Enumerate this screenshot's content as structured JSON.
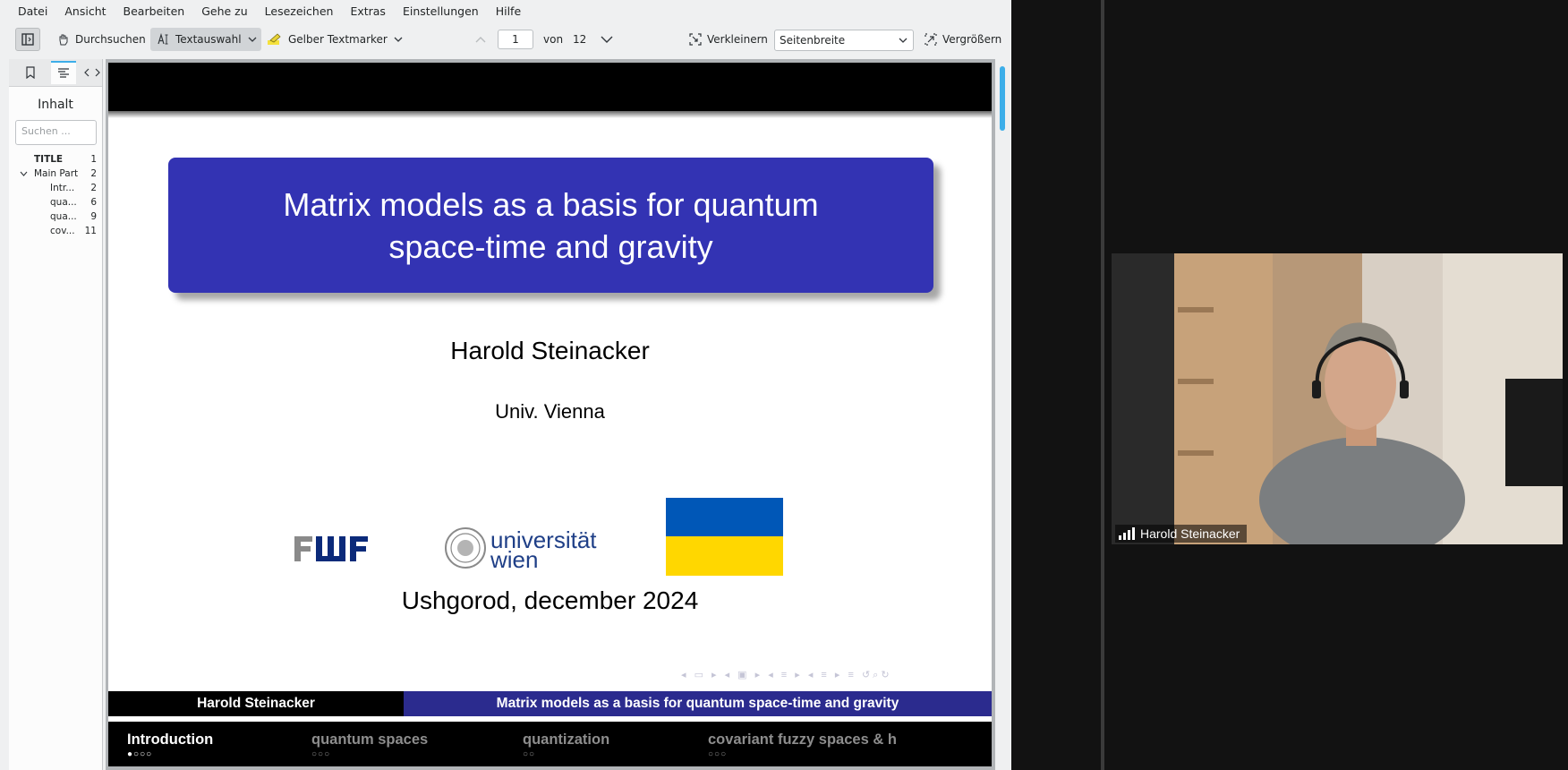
{
  "menubar": [
    "Datei",
    "Ansicht",
    "Bearbeiten",
    "Gehe zu",
    "Lesezeichen",
    "Extras",
    "Einstellungen",
    "Hilfe"
  ],
  "toolbar": {
    "browse_label": "Durchsuchen",
    "textselect_label": "Textauswahl",
    "highlighter_label": "Gelber Textmarker",
    "current_page": "1",
    "of_label": "von",
    "total_pages": "12",
    "zoom_out_label": "Verkleinern",
    "zoom_mode": "Seitenbreite",
    "zoom_in_label": "Vergrößern"
  },
  "sidebar": {
    "title": "Inhalt",
    "search_placeholder": "Suchen ...",
    "toc": [
      {
        "label": "TITLE",
        "page": "1"
      },
      {
        "label": "Main Part",
        "page": "2"
      },
      {
        "label": "Intr...",
        "page": "2"
      },
      {
        "label": "qua...",
        "page": "6"
      },
      {
        "label": "qua...",
        "page": "9"
      },
      {
        "label": "cov...",
        "page": "11"
      }
    ]
  },
  "slide": {
    "title_line1": "Matrix models as a basis for quantum",
    "title_line2": "space-time and gravity",
    "author": "Harold Steinacker",
    "affiliation": "Univ. Vienna",
    "logo_fwf": "FWF",
    "logo_uni_line1": "universität",
    "logo_uni_line2": "wien",
    "place_date": "Ushgorod, december 2024",
    "footer_author": "Harold Steinacker",
    "footer_title": "Matrix models as a basis for quantum space-time and gravity",
    "sections": [
      {
        "label": "Introduction",
        "dots": "●○○○"
      },
      {
        "label": "quantum spaces",
        "dots": "○○○"
      },
      {
        "label": "quantization",
        "dots": "○○"
      },
      {
        "label": "covariant fuzzy spaces & h",
        "dots": "○○○"
      }
    ],
    "colors": {
      "title_box": "#3333b3",
      "footer_right": "#2b2b8e",
      "flag_blue": "#0057b7",
      "flag_yellow": "#ffd700"
    }
  },
  "video": {
    "participant_name": "Harold Steinacker"
  },
  "icons": [
    "sidebar-toggle-icon",
    "hand-icon",
    "text-cursor-icon",
    "highlighter-icon",
    "chevron-up-icon",
    "chevron-down-icon",
    "zoom-out-icon",
    "zoom-in-icon",
    "bookmark-icon",
    "toc-icon",
    "signal-icon"
  ]
}
